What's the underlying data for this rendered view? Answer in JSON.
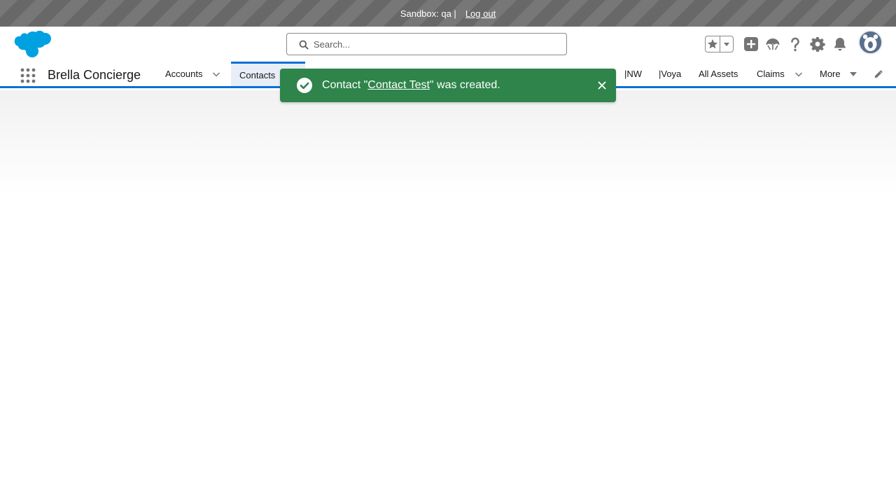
{
  "sandbox_bar": {
    "text": "Sandbox: qa |",
    "logout_label": "Log out"
  },
  "header": {
    "search_placeholder": "Search...",
    "icons": [
      "favorites-star-icon",
      "chevron-down-icon",
      "add-icon",
      "trailhead-icon",
      "help-icon",
      "gear-icon",
      "notifications-bell-icon",
      "avatar"
    ]
  },
  "nav": {
    "app_name": "Brella Concierge",
    "items": [
      {
        "label": "Accounts",
        "has_dropdown": true
      },
      {
        "label": "Contacts",
        "active": true
      },
      {
        "label": "|NW"
      },
      {
        "label": "|Voya"
      },
      {
        "label": "All Assets"
      },
      {
        "label": "Claims",
        "has_dropdown": true
      },
      {
        "label": "More",
        "has_dropdown": true
      }
    ]
  },
  "toast": {
    "prefix": "Contact \"",
    "link_text": "Contact Test",
    "suffix": "\" was created.",
    "status": "success"
  },
  "colors": {
    "brand_blue": "#0b70d6",
    "toast_green": "#2e844a",
    "salesforce_cloud": "#00a1e0"
  }
}
